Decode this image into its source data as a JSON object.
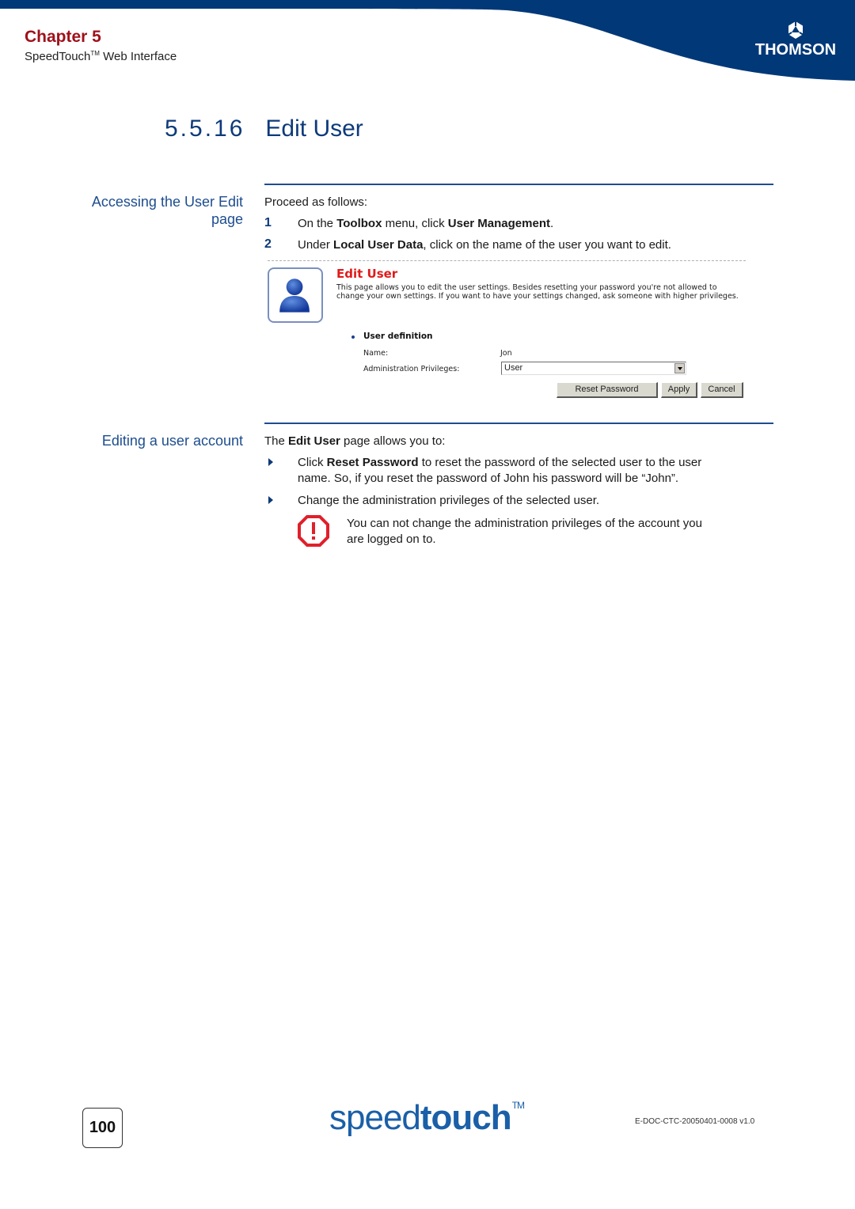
{
  "header": {
    "chapter": "Chapter 5",
    "subtitle_main": "SpeedTouch",
    "subtitle_tm": "TM",
    "subtitle_rest": " Web Interface",
    "logo_text": "THOMSON",
    "colors": {
      "banner": "#003878",
      "chapter": "#a0101a",
      "heading": "#0d3a7a"
    }
  },
  "section": {
    "number": "5.5.16",
    "title": "Edit User"
  },
  "accessing": {
    "heading_line1": "Accessing the User Edit",
    "heading_line2": "page",
    "intro": "Proceed as follows:",
    "steps": [
      {
        "num": "1",
        "pre": "On the ",
        "b1": "Toolbox",
        "mid": " menu, click ",
        "b2": "User Management",
        "post": "."
      },
      {
        "num": "2",
        "pre": "Under ",
        "b1": "Local User Data",
        "post": ", click on the name of the user you want to edit."
      }
    ]
  },
  "screenshot": {
    "title": "Edit User",
    "description": "This page allows you to edit the user settings. Besides resetting your password you're not allowed to change your own settings. If you want to have your settings changed, ask someone with higher privileges.",
    "section_label": "User definition",
    "name_label": "Name:",
    "name_value": "Jon",
    "privileges_label": "Administration Privileges:",
    "privileges_value": "User",
    "buttons": {
      "reset": "Reset Password",
      "apply": "Apply",
      "cancel": "Cancel"
    }
  },
  "editing": {
    "heading": "Editing a user account",
    "intro_pre": "The ",
    "intro_bold": "Edit User",
    "intro_post": " page allows you to:",
    "bullets": [
      {
        "pre": "Click ",
        "bold": "Reset Password",
        "line1_post": " to reset the password of the selected user to the user",
        "line2": "name. So, if you reset the password of John his password will be “John”."
      },
      {
        "text": "Change the administration privileges of the selected user."
      }
    ],
    "warning_line1": "You can not change the administration privileges of the account you",
    "warning_line2": "are logged on to."
  },
  "footer": {
    "page_number": "100",
    "brand_light": "speed",
    "brand_bold": "touch",
    "brand_tm": "TM",
    "doc_id": "E-DOC-CTC-20050401-0008 v1.0"
  }
}
